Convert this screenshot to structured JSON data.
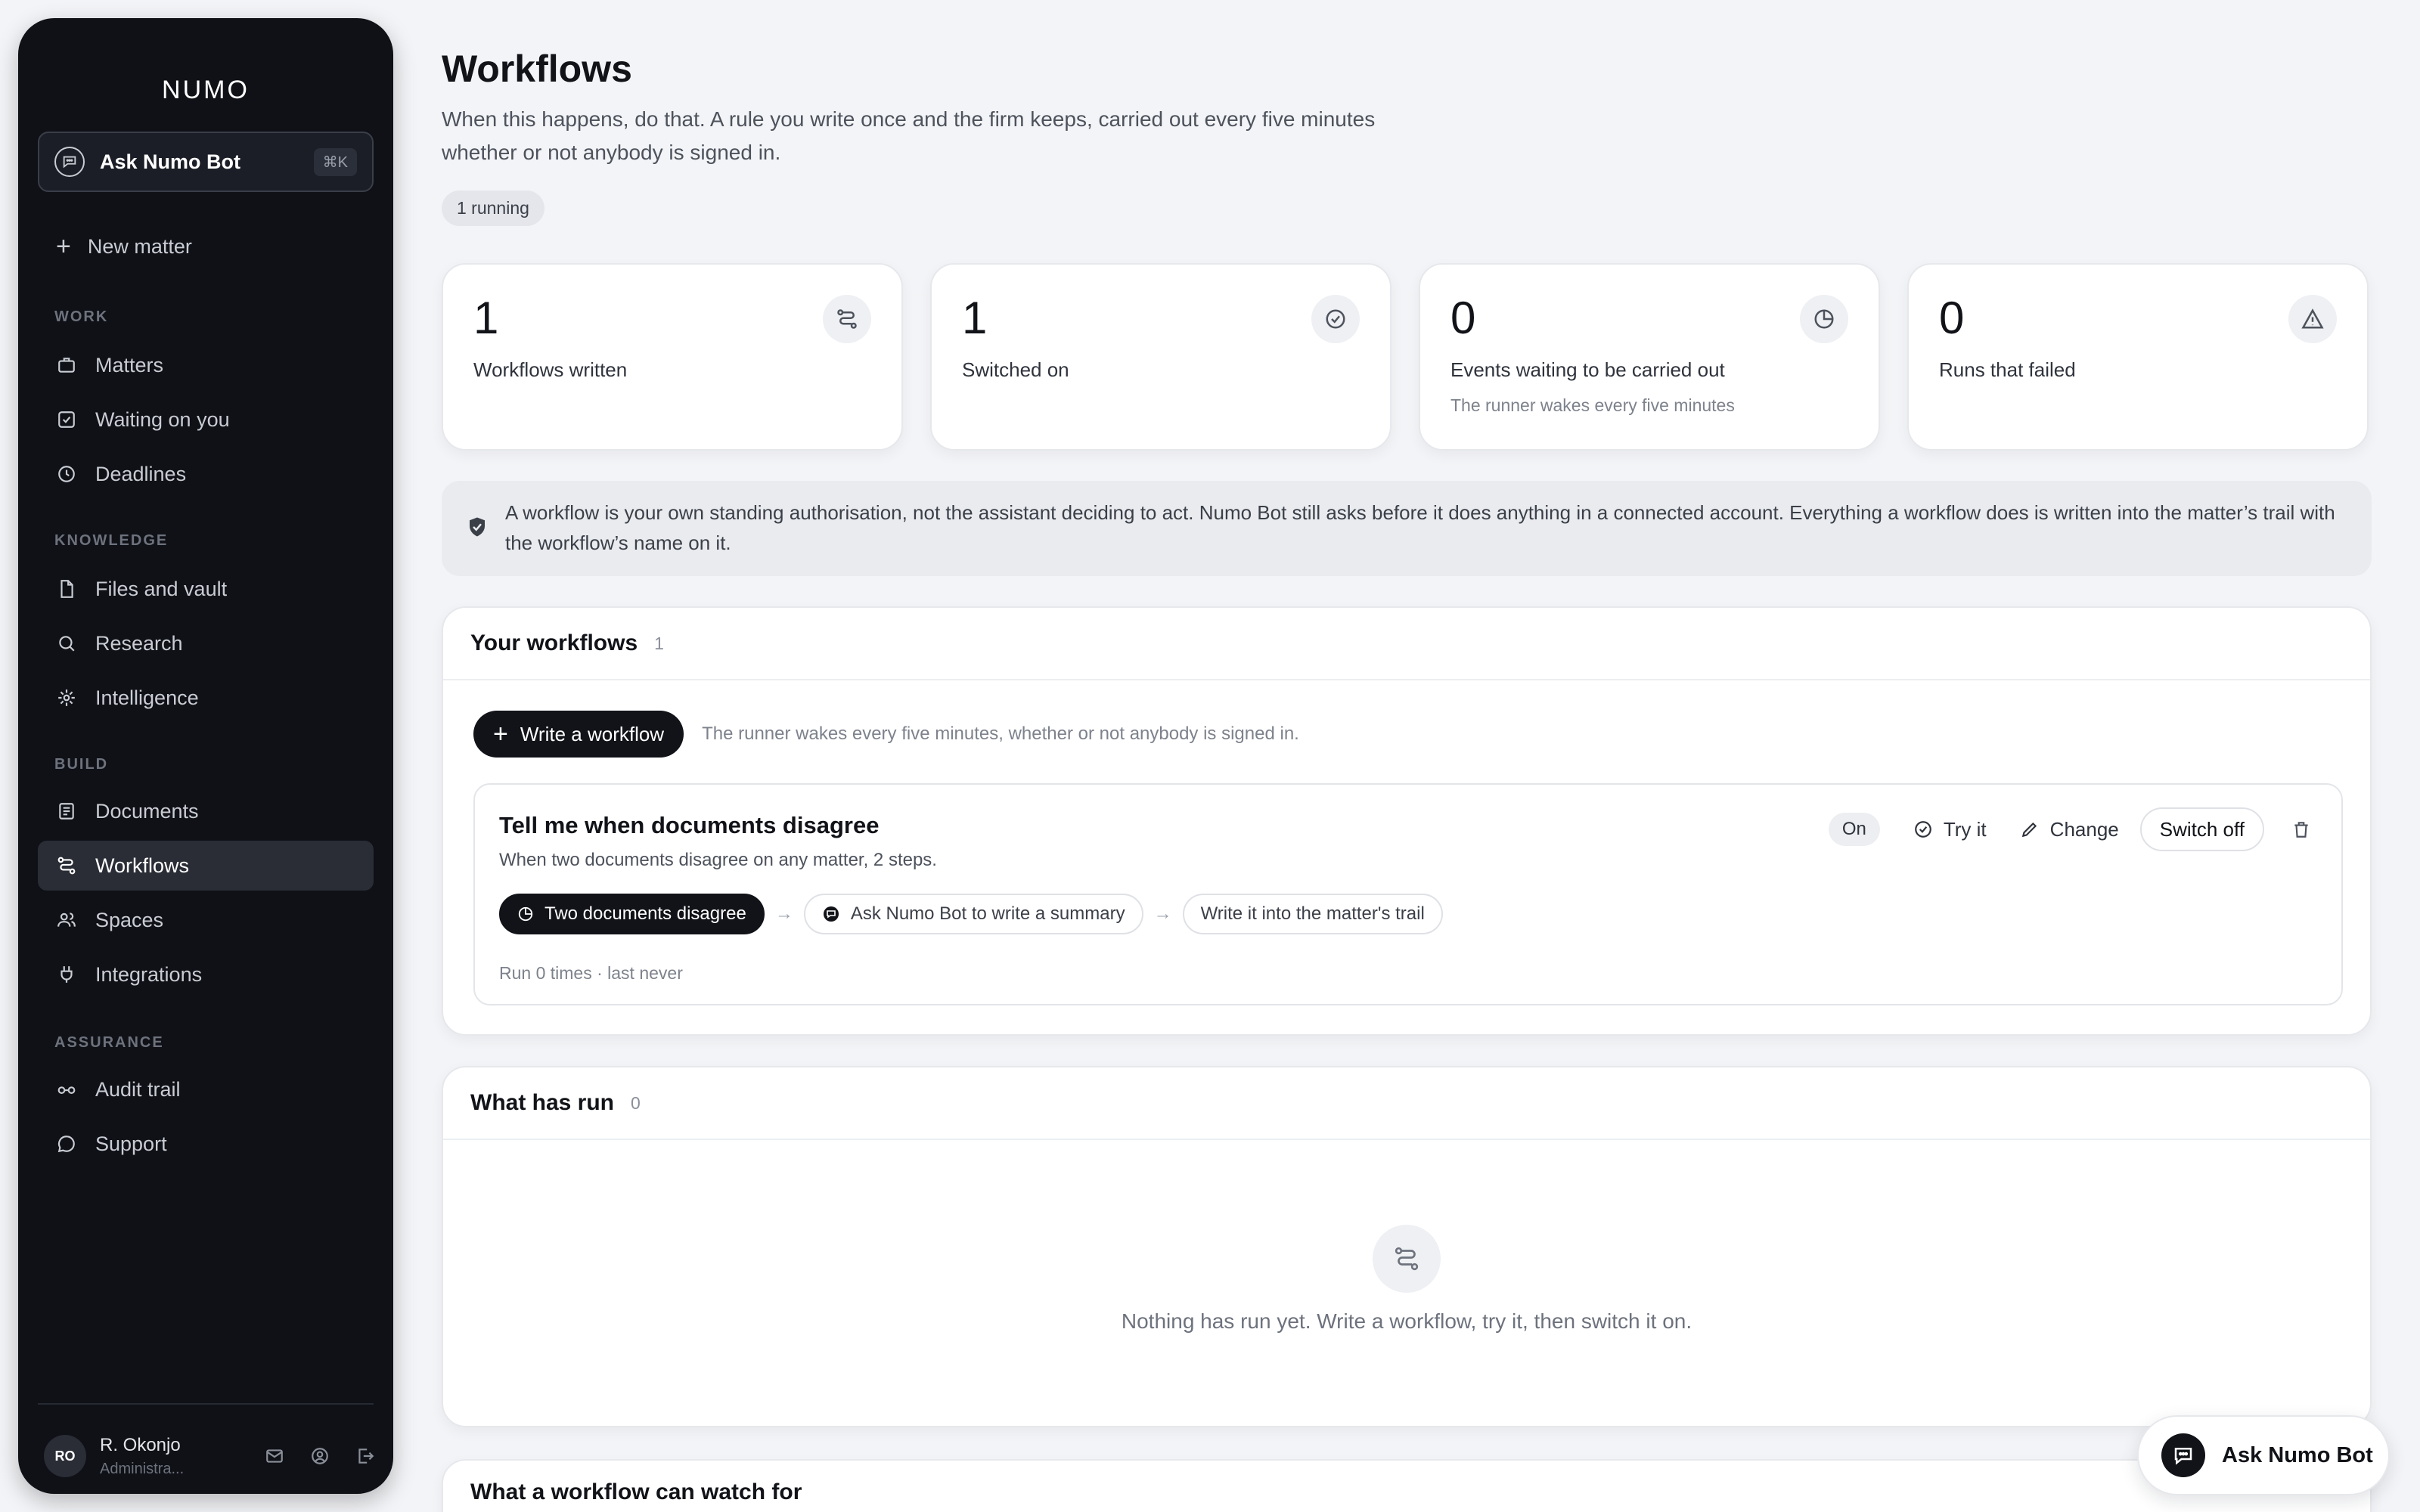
{
  "sidebar": {
    "logo": "NUMO",
    "ask_label": "Ask Numo Bot",
    "ask_shortcut": "⌘K",
    "new_matter": "New matter",
    "sections": {
      "work": "WORK",
      "knowledge": "KNOWLEDGE",
      "build": "BUILD",
      "assurance": "ASSURANCE"
    },
    "items": {
      "matters": "Matters",
      "waiting": "Waiting on you",
      "deadlines": "Deadlines",
      "files": "Files and vault",
      "research": "Research",
      "intelligence": "Intelligence",
      "documents": "Documents",
      "workflows": "Workflows",
      "spaces": "Spaces",
      "integrations": "Integrations",
      "audit": "Audit trail",
      "support": "Support"
    },
    "user": {
      "initials": "RO",
      "name": "R. Okonjo",
      "role": "Administra..."
    }
  },
  "main": {
    "title": "Workflows",
    "subtitle": "When this happens, do that. A rule you write once and the firm keeps, carried out every five minutes whether or not anybody is signed in.",
    "running_badge": "1 running",
    "stats": [
      {
        "num": "1",
        "label": "Workflows written",
        "sub": ""
      },
      {
        "num": "1",
        "label": "Switched on",
        "sub": ""
      },
      {
        "num": "0",
        "label": "Events waiting to be carried out",
        "sub": "The runner wakes every five minutes"
      },
      {
        "num": "0",
        "label": "Runs that failed",
        "sub": ""
      }
    ],
    "notice": "A workflow is your own standing authorisation, not the assistant deciding to act. Numo Bot still asks before it does anything in a connected account. Everything a workflow does is written into the matter’s trail with the workflow’s name on it.",
    "your_workflows": {
      "heading": "Your workflows",
      "count": "1",
      "write_label": "Write a workflow",
      "write_hint": "The runner wakes every five minutes, whether or not anybody is signed in.",
      "workflow": {
        "name": "Tell me when documents disagree",
        "desc": "When two documents disagree on any matter, 2 steps.",
        "status": "On",
        "try_label": "Try it",
        "change_label": "Change",
        "switch_label": "Switch off",
        "steps": [
          "Two documents disagree",
          "Ask Numo Bot to write a summary",
          "Write it into the matter's trail"
        ],
        "run_info": "Run 0 times · last never"
      }
    },
    "what_has_run": {
      "heading": "What has run",
      "count": "0",
      "empty": "Nothing has run yet. Write a workflow, try it, then switch it on."
    },
    "watch_for": {
      "heading": "What a workflow can watch for"
    },
    "floating_ask": "Ask Numo Bot"
  }
}
